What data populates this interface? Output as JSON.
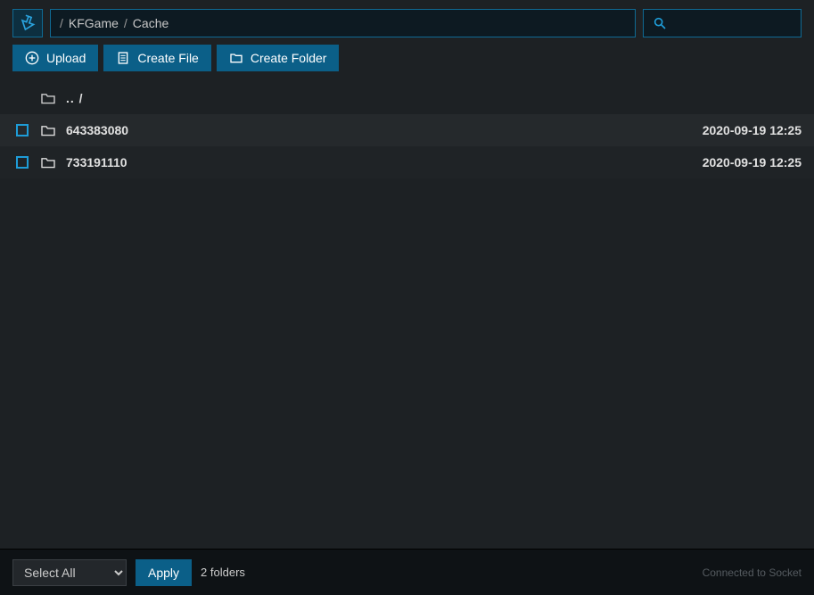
{
  "breadcrumb": {
    "sep": "/",
    "part1": "KFGame",
    "part2": "Cache"
  },
  "toolbar": {
    "upload_label": "Upload",
    "create_file_label": "Create File",
    "create_folder_label": "Create Folder"
  },
  "listing": {
    "parent_label": ".. /",
    "rows": [
      {
        "name": "643383080",
        "date": "2020-09-19 12:25"
      },
      {
        "name": "733191110",
        "date": "2020-09-19 12:25"
      }
    ]
  },
  "footer": {
    "select_all_label": "Select All",
    "apply_label": "Apply",
    "folder_count": "2 folders",
    "socket_status": "Connected to Socket"
  }
}
